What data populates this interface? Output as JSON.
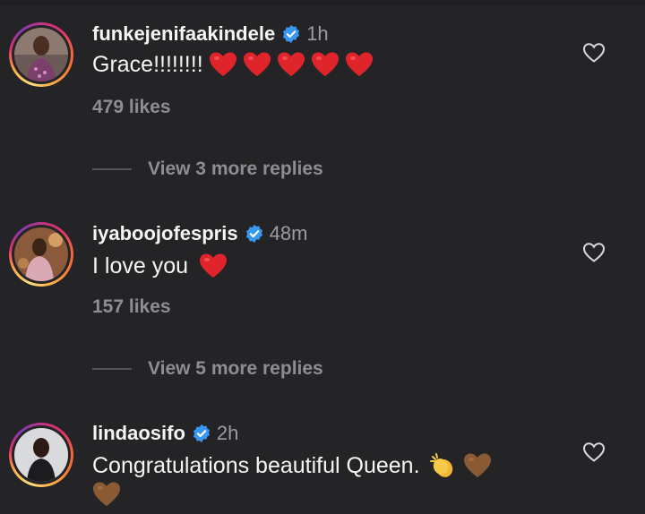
{
  "comments": [
    {
      "username": "funkejenifaakindele",
      "time": "1h",
      "text": "Grace!!!!!!!!",
      "emojis": [
        "red-heart",
        "red-heart",
        "red-heart",
        "red-heart",
        "red-heart"
      ],
      "likes": "479 likes",
      "replies": "View 3 more replies"
    },
    {
      "username": "iyaboojofespris",
      "time": "48m",
      "text": "I love you",
      "emojis": [
        "red-heart"
      ],
      "likes": "157 likes",
      "replies": "View 5 more replies"
    },
    {
      "username": "lindaosifo",
      "time": "2h",
      "text": "Congratulations beautiful Queen.",
      "emojis": [
        "clapping-hands",
        "brown-heart",
        "brown-heart"
      ]
    }
  ],
  "colors": {
    "background": "#242426",
    "verified": "#3897f0",
    "red_heart": "#e0242b",
    "brown_heart": "#8a5a35",
    "muted": "#8e8e92"
  }
}
